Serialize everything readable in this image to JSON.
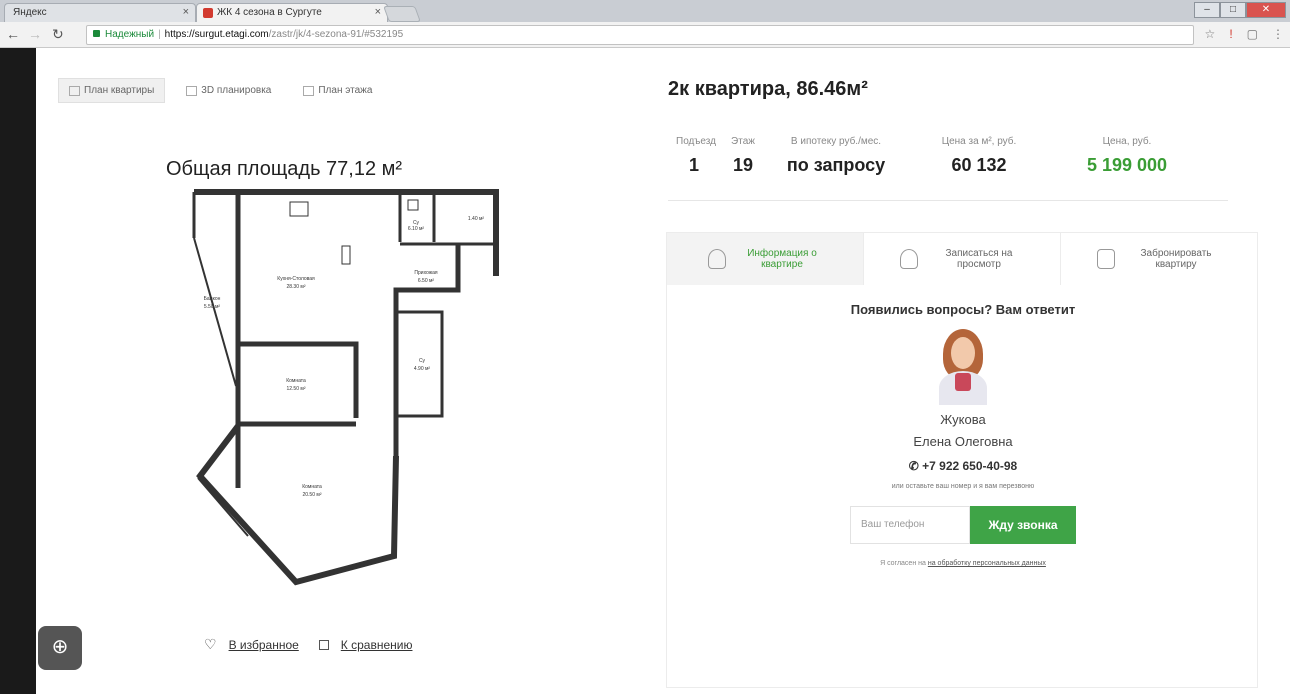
{
  "browser": {
    "tabs": [
      {
        "title": "Яндекс"
      },
      {
        "title": "ЖК 4 сезона в Сургуте"
      }
    ],
    "url": {
      "secure_label": "Надежный",
      "host": "https://surgut.etagi.com",
      "path": "/zastr/jk/4-sezona-91/#532195"
    }
  },
  "plan": {
    "tabs": [
      "План квартиры",
      "3D планировка",
      "План этажа"
    ],
    "total_area": "Общая площадь 77,12 м²",
    "rooms": [
      {
        "name": "Балкон",
        "area": "5.50 м²"
      },
      {
        "name": "Кухня-Столовая",
        "area": "28.30 м²"
      },
      {
        "name": "Су",
        "area": "6.10 м²"
      },
      {
        "name": "",
        "area": "1.40 м²"
      },
      {
        "name": "Прихожая",
        "area": "6.50 м²"
      },
      {
        "name": "Комната",
        "area": "12.50 м²"
      },
      {
        "name": "Су",
        "area": "4.90 м²"
      },
      {
        "name": "Комната",
        "area": "20.50 м²"
      }
    ],
    "favorites_label": "В избранное",
    "compare_label": "К сравнению"
  },
  "apartment": {
    "title": "2к квартира, 86.46м²",
    "stats": [
      {
        "label": "Подъезд",
        "value": "1"
      },
      {
        "label": "Этаж",
        "value": "19"
      },
      {
        "label": "В ипотеку руб./мес.",
        "value": "по запросу"
      },
      {
        "label": "Цена за м², руб.",
        "value": "60 132"
      },
      {
        "label": "Цена, руб.",
        "value": "5 199 000"
      }
    ],
    "price_color": "#3a9d35"
  },
  "actions": [
    {
      "label": "Информация о квартире"
    },
    {
      "label": "Записаться на просмотр"
    },
    {
      "label": "Забронировать квартиру"
    }
  ],
  "contact": {
    "question": "Появились вопросы? Вам ответит",
    "surname": "Жукова",
    "name": "Елена Олеговна",
    "phone": "+7 922 650-40-98",
    "hint": "или оставьте ваш номер и я вам перезвоню",
    "phone_placeholder": "Ваш телефон",
    "callback_label": "Жду звонка",
    "consent_prefix": "Я согласен на",
    "consent_link": "на обработку персональных данных"
  }
}
